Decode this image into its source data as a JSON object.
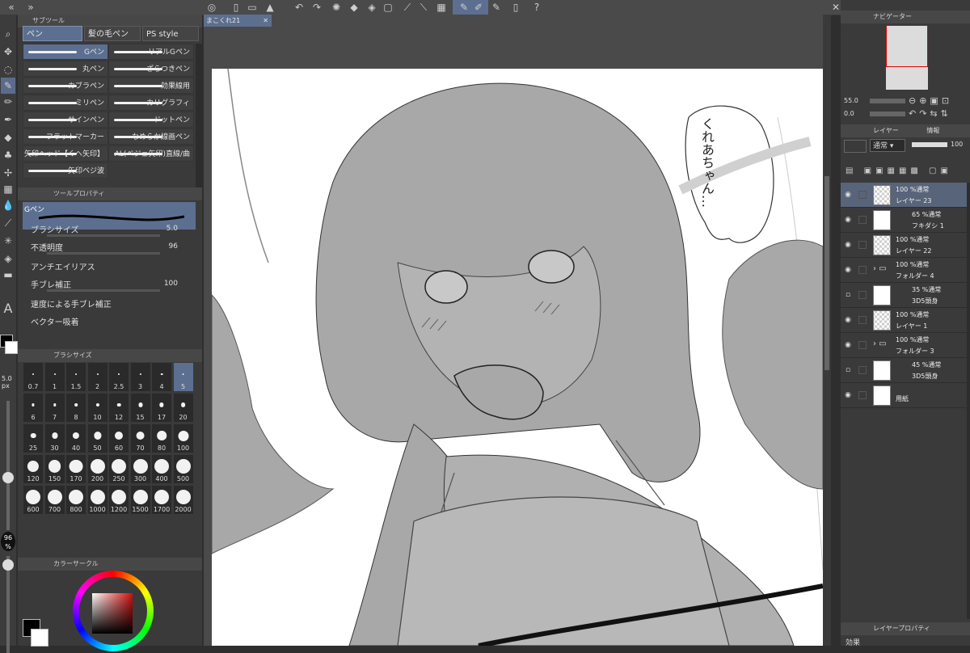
{
  "command_bar": {
    "icons": [
      "left-chevron-icon",
      "right-chevron-icon",
      "clip-studio-icon",
      "new-file-icon",
      "open-folder-icon",
      "save-icon",
      "undo-icon",
      "redo-icon",
      "loading-icon",
      "fill-icon",
      "transform-icon",
      "rotate-icon",
      "snap-ruler-icon",
      "snap-special-icon",
      "snap-grid-icon",
      "help-icon"
    ]
  },
  "subtool_panel": {
    "title": "サブツール",
    "tabs": [
      "ペン",
      "髪の毛ペン",
      "PS style"
    ],
    "brushes": [
      {
        "name": "Gペン",
        "active": true
      },
      {
        "name": "リアルGペン",
        "active": false
      },
      {
        "name": "丸ペン",
        "active": false
      },
      {
        "name": "ざらつきペン",
        "active": false
      },
      {
        "name": "カブラペン",
        "active": false
      },
      {
        "name": "効果線用",
        "active": false
      },
      {
        "name": "ミリペン",
        "active": false
      },
      {
        "name": "カリグラフィ",
        "active": false
      },
      {
        "name": "サインペン",
        "active": false
      },
      {
        "name": "ドットペン",
        "active": false
      },
      {
        "name": "フラットマーカー",
        "active": false
      },
      {
        "name": "なめらか線画ペン",
        "active": false
      },
      {
        "name": "矢印ヘッド【くヘ矢印】折れ線",
        "active": false
      },
      {
        "name": "AL(ベジェ矢印)直線/曲",
        "active": false
      },
      {
        "name": "矢印ベジ波",
        "active": false
      }
    ]
  },
  "tool_property": {
    "title": "ツールプロパティ",
    "preset_name": "Gペン",
    "rows": [
      {
        "label": "ブラシサイズ",
        "value": "5.0"
      },
      {
        "label": "不透明度",
        "value": "96"
      },
      {
        "label": "アンチエイリアス",
        "value": ""
      },
      {
        "label": "手ブレ補正",
        "value": "100"
      },
      {
        "label": "速度による手ブレ補正",
        "value": ""
      },
      {
        "label": "ベクター吸着",
        "value": ""
      }
    ]
  },
  "brush_size_panel": {
    "title": "ブラシサイズ",
    "sizes": [
      "0.7",
      "1",
      "1.5",
      "2",
      "2.5",
      "3",
      "4",
      "5",
      "6",
      "7",
      "8",
      "10",
      "12",
      "15",
      "17",
      "20",
      "25",
      "30",
      "40",
      "50",
      "60",
      "70",
      "80",
      "100",
      "120",
      "150",
      "170",
      "200",
      "250",
      "300",
      "400",
      "500",
      "600",
      "700",
      "800",
      "1000",
      "1200",
      "1500",
      "1700",
      "2000"
    ],
    "active_size": "5"
  },
  "size_slider": {
    "value": "5.0",
    "unit": "px"
  },
  "opacity_slider": {
    "value": "96",
    "unit": "%"
  },
  "color_panel": {
    "title": "カラーサークル",
    "main_color": "#000000",
    "sub_color": "#ffffff",
    "hue_square_color": "#d01010"
  },
  "document": {
    "tab_title": "まこくれ21",
    "speech_text": "くれあちゃん…"
  },
  "navigator": {
    "title": "ナビゲーター",
    "zoom": "55.0",
    "rotation": "0.0"
  },
  "layer_panel": {
    "tabs": [
      "レイヤー",
      "情報"
    ],
    "blend_mode": "通常",
    "opacity": "100",
    "layers": [
      {
        "opacity_mode": "100 %通常",
        "name": "レイヤー 23",
        "selected": true,
        "visible": true,
        "type": "raster"
      },
      {
        "opacity_mode": "65 %通常",
        "name": "フキダシ 1",
        "selected": false,
        "visible": true,
        "type": "balloon"
      },
      {
        "opacity_mode": "100 %通常",
        "name": "レイヤー 22",
        "selected": false,
        "visible": true,
        "type": "raster"
      },
      {
        "opacity_mode": "100 %通常",
        "name": "フォルダー 4",
        "selected": false,
        "visible": true,
        "type": "folder"
      },
      {
        "opacity_mode": "35 %通常",
        "name": "3D5頭身",
        "selected": false,
        "visible": false,
        "type": "3d"
      },
      {
        "opacity_mode": "100 %通常",
        "name": "レイヤー 1",
        "selected": false,
        "visible": true,
        "type": "raster"
      },
      {
        "opacity_mode": "100 %通常",
        "name": "フォルダー 3",
        "selected": false,
        "visible": true,
        "type": "folder"
      },
      {
        "opacity_mode": "45 %通常",
        "name": "3D5頭身",
        "selected": false,
        "visible": false,
        "type": "3d"
      },
      {
        "opacity_mode": "",
        "name": "用紙",
        "selected": false,
        "visible": true,
        "type": "paper"
      }
    ]
  },
  "layer_property": {
    "title": "レイヤープロパティ",
    "effect_label": "効果"
  }
}
